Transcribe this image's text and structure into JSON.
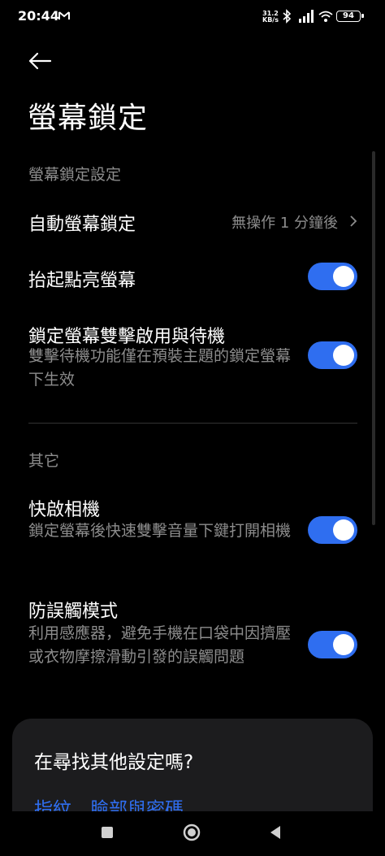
{
  "status_bar": {
    "time": "20:44",
    "speed_value": "31.2",
    "speed_unit": "KB/s",
    "battery": "94"
  },
  "header": {
    "back_icon": "arrow-left-icon",
    "title": "螢幕鎖定"
  },
  "sections": [
    {
      "title": "螢幕鎖定設定",
      "items": [
        {
          "title": "自動螢幕鎖定",
          "value": "無操作 1 分鐘後"
        },
        {
          "title": "抬起點亮螢幕",
          "toggle": true
        },
        {
          "title": "鎖定螢幕雙擊啟用與待機",
          "subtitle": "雙擊待機功能僅在預裝主題的鎖定螢幕下生效",
          "toggle": true
        }
      ]
    },
    {
      "title": "其它",
      "items": [
        {
          "title": "快啟相機",
          "subtitle": "鎖定螢幕後快速雙擊音量下鍵打開相機",
          "toggle": true
        },
        {
          "title": "防誤觸模式",
          "subtitle": "利用感應器，避免手機在口袋中因擠壓或衣物摩擦滑動引發的誤觸問題",
          "toggle": true
        }
      ]
    }
  ],
  "suggestion_card": {
    "title": "在尋找其他設定嗎?",
    "links": "指紋、臉部與密碼"
  },
  "colors": {
    "background": "#000000",
    "accent": "#2f6ef0",
    "secondary_text": "#8c8c8c",
    "card": "#1c1c1e"
  },
  "nav": [
    "square-recents-icon",
    "circle-home-icon",
    "triangle-back-icon"
  ]
}
